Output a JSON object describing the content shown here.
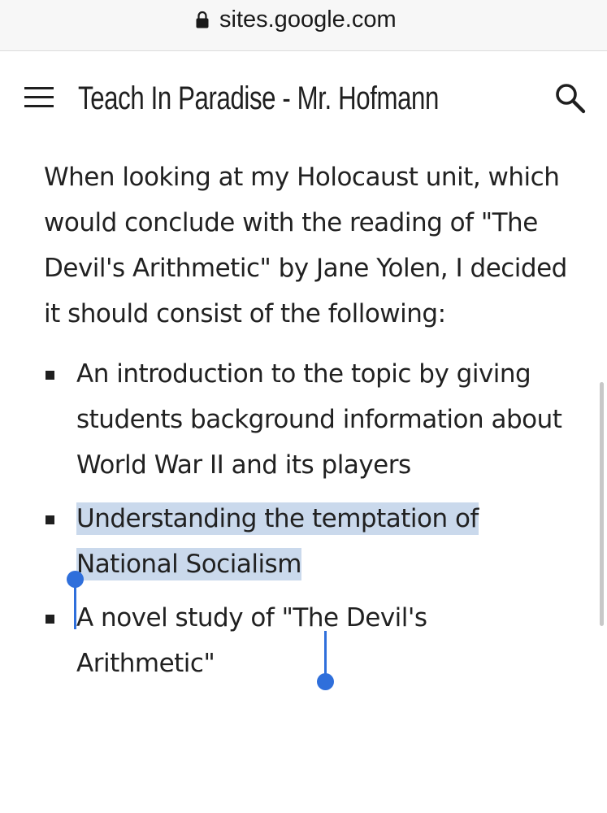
{
  "browser": {
    "url": "sites.google.com",
    "lock_icon": "lock-icon"
  },
  "header": {
    "title": "Teach In Paradise - Mr. Hofmann",
    "menu_icon": "hamburger-menu-icon",
    "search_icon": "search-icon"
  },
  "main": {
    "paragraph": "When looking at my Holocaust unit, which would conclude with the reading of \"The Devil's Arithmetic\" by Jane Yolen, I decided it should consist of the following:",
    "items": [
      "An introduction to the topic by giving students background information about World War II and its players",
      "Understanding the temptation of National Socialism",
      "A novel study of \"The Devil's Arithmetic\""
    ],
    "selected_text": "Understanding the temptation of National Socialism"
  },
  "colors": {
    "selection_background": "#cad9ec",
    "selection_handle": "#2f6fdb"
  }
}
